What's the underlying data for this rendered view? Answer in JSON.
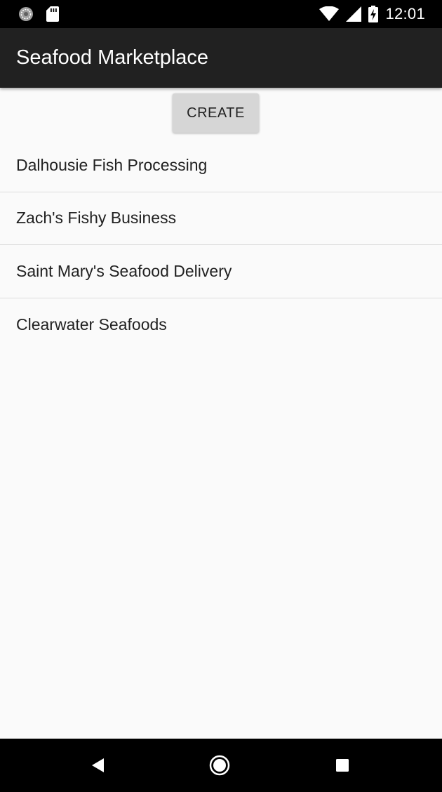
{
  "status_bar": {
    "time": "12:01",
    "left_icons": [
      "sync-icon",
      "sd-card-icon"
    ],
    "right_icons": [
      "wifi-icon",
      "cell-signal-icon",
      "battery-charging-icon"
    ]
  },
  "app_bar": {
    "title": "Seafood Marketplace"
  },
  "actions": {
    "create_label": "CREATE"
  },
  "list": {
    "items": [
      {
        "label": "Dalhousie Fish Processing"
      },
      {
        "label": "Zach's Fishy Business"
      },
      {
        "label": "Saint Mary's Seafood Delivery"
      },
      {
        "label": "Clearwater Seafoods"
      }
    ]
  },
  "nav_bar": {
    "buttons": [
      "back-icon",
      "home-icon",
      "recents-icon"
    ]
  },
  "colors": {
    "status_bar": "#000000",
    "app_bar": "#212121",
    "background": "#fafafa",
    "button": "#d6d6d6",
    "divider": "#dcdcdc",
    "nav_bar": "#000000"
  }
}
